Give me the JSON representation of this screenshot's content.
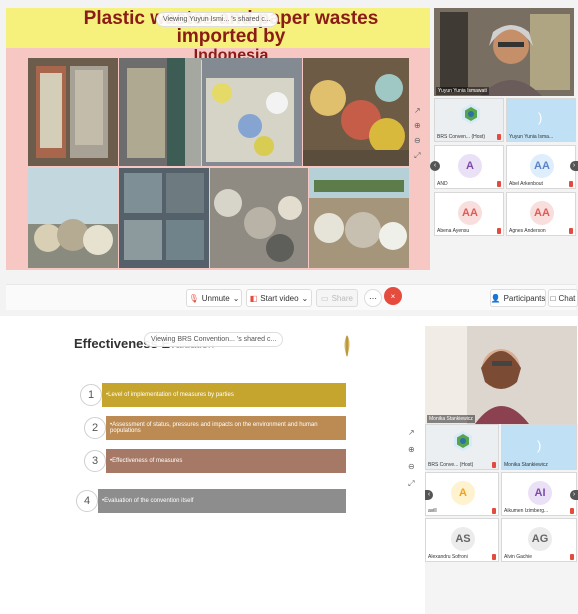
{
  "top": {
    "slide": {
      "title_line1": "Plastic wastes and paper wastes imported by",
      "title_line2": "Indonesia"
    },
    "share_label": "Viewing Yuyun Ismi... 's shared c...",
    "speaker_name": "Yuyun Yunia Ismawati",
    "participants": [
      {
        "name": "BRS Conven... (Host)",
        "avatar": "logo"
      },
      {
        "name": "Yuyun Yunia Isma...",
        "avatar": "sound"
      },
      {
        "name": "AND",
        "avatar": "A"
      },
      {
        "name": "Abel Arkenbout",
        "avatar": "AA"
      },
      {
        "name": "Abena Ayensu",
        "avatar": "AA"
      },
      {
        "name": "Agnes Anderson",
        "avatar": "AA"
      }
    ],
    "controls": {
      "unmute": "Unmute",
      "start_video": "Start video",
      "share": "Share",
      "participants": "Participants",
      "chat": "Chat"
    }
  },
  "bottom": {
    "share_label": "Viewing BRS Convention... 's shared c...",
    "slide_title": "Effectiveness E",
    "slide_title_tail": "valuation",
    "items": [
      {
        "number": "1",
        "text": "•Level of implementation of measures by parties",
        "color": "#c6a52f"
      },
      {
        "number": "2",
        "text": "•Assessment of status, pressures and impacts on the environment and human populations",
        "color": "#bc8b54"
      },
      {
        "number": "3",
        "text": "•Effectiveness of measures",
        "color": "#a57966"
      },
      {
        "number": "4",
        "text": "•Evaluation of the convention itself",
        "color": "#8d8d8d"
      }
    ],
    "speaker_name": "Monika Stankiewicz",
    "participants": [
      {
        "name": "BRS Conve... (Host)",
        "avatar": "logo"
      },
      {
        "name": "Monika Stankiewicz",
        "avatar": "sound"
      },
      {
        "name": "avill",
        "avatar": "A"
      },
      {
        "name": "Aikumen Izimberg...",
        "avatar": "AI"
      },
      {
        "name": "Alexandru Sofroni",
        "avatar": "AS"
      },
      {
        "name": "Alvin Gachie",
        "avatar": "AG"
      }
    ]
  },
  "colors": {
    "title_band": "#f6f17c",
    "title_text": "#8b1b16",
    "slide_bg": "#f7c7c3",
    "leave": "#e54c3e"
  }
}
